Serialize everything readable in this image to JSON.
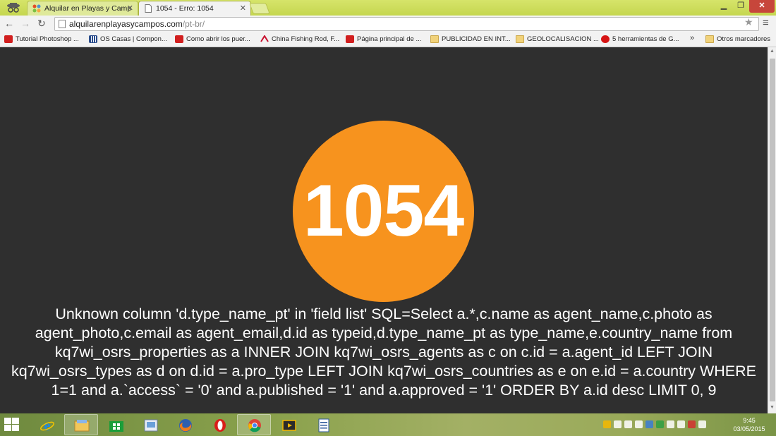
{
  "browser": {
    "tabs": [
      {
        "title": "Alquilar en Playas y Camp"
      },
      {
        "title": "1054 - Erro: 1054"
      }
    ],
    "url_host": "alquilarenplayasycampos.com",
    "url_path": "/pt-br/",
    "bookmarks": [
      {
        "label": "Tutorial Photoshop ...",
        "icon": "youtube-icon"
      },
      {
        "label": "OS Casas | Compon...",
        "icon": "grid-icon"
      },
      {
        "label": "Como abrir los puer...",
        "icon": "youtube-icon"
      },
      {
        "label": "China Fishing Rod, F...",
        "icon": "aliexpress-icon"
      },
      {
        "label": "Página principal de ...",
        "icon": "youtube-icon"
      },
      {
        "label": "PUBLICIDAD EN INT...",
        "icon": "folder-icon"
      },
      {
        "label": "GEOLOCALISACION ...",
        "icon": "folder-icon"
      },
      {
        "label": "5 herramientas de G...",
        "icon": "red-circle-icon"
      },
      {
        "label": "Otros marcadores",
        "icon": "folder-icon"
      }
    ],
    "bookmarks_more": "»"
  },
  "page": {
    "error_code": "1054",
    "error_message": "Unknown column 'd.type_name_pt' in 'field list' SQL=Select a.*,c.name as agent_name,c.photo as agent_photo,c.email as agent_email,d.id as typeid,d.type_name_pt as type_name,e.country_name from kq7wi_osrs_properties as a INNER JOIN kq7wi_osrs_agents as c on c.id = a.agent_id LEFT JOIN kq7wi_osrs_types as d on d.id = a.pro_type LEFT JOIN kq7wi_osrs_countries as e on e.id = a.country WHERE 1=1 and a.`access` = '0' and a.published = '1' and a.approved = '1' ORDER BY a.id desc LIMIT 0, 9",
    "circle_color": "#f7931e",
    "background_color": "#2f2f2f"
  },
  "taskbar": {
    "apps": [
      "internet-explorer-icon",
      "file-explorer-icon",
      "store-icon",
      "picture-viewer-icon",
      "firefox-icon",
      "opera-icon",
      "chrome-icon",
      "media-icon",
      "document-icon"
    ],
    "time": "9:45",
    "date": "03/05/2015"
  }
}
